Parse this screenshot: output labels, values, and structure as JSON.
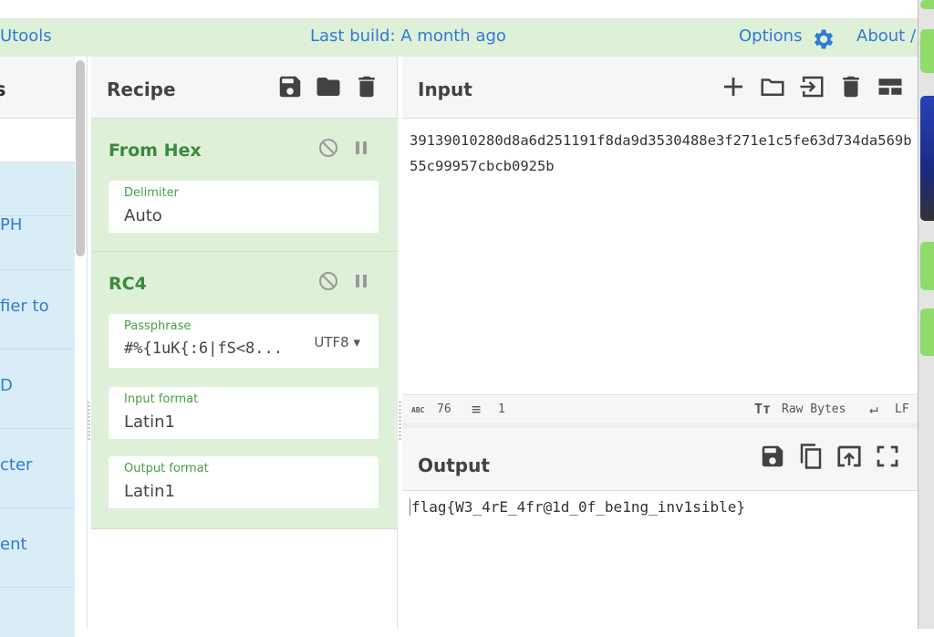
{
  "banner": {
    "left_link": "Utools",
    "last_build": "Last build: A month ago",
    "options": "Options",
    "about": "About /"
  },
  "operations": {
    "header_partial": "s",
    "items": [
      "",
      "PH",
      "fier to",
      "D",
      "cter",
      "ent"
    ]
  },
  "recipe": {
    "title": "Recipe",
    "operations": [
      {
        "name": "From Hex",
        "fields": [
          {
            "label": "Delimiter",
            "value": "Auto"
          }
        ]
      },
      {
        "name": "RC4",
        "fields": [
          {
            "label": "Passphrase",
            "value": "#%{1uK{:6|fS<8...",
            "encoding": "UTF8"
          },
          {
            "label": "Input format",
            "value": "Latin1"
          },
          {
            "label": "Output format",
            "value": "Latin1"
          }
        ]
      }
    ]
  },
  "input": {
    "title": "Input",
    "value": "39139010280d8a6d251191f8da9d3530488e3f271e1c5fe63d734da569b55c99957cbcb0925b",
    "status": {
      "length": "76",
      "lines": "1",
      "encoding": "Raw Bytes",
      "eol": "LF"
    }
  },
  "output": {
    "title": "Output",
    "value": "flag{W3_4rE_4fr@1d_0f_be1ng_inv1sible}"
  },
  "colors": {
    "banner_bg": "#dff0d8",
    "link": "#2f7bd8",
    "op_green": "#3c8a3c",
    "ops_list_bg": "#d9edf7"
  }
}
